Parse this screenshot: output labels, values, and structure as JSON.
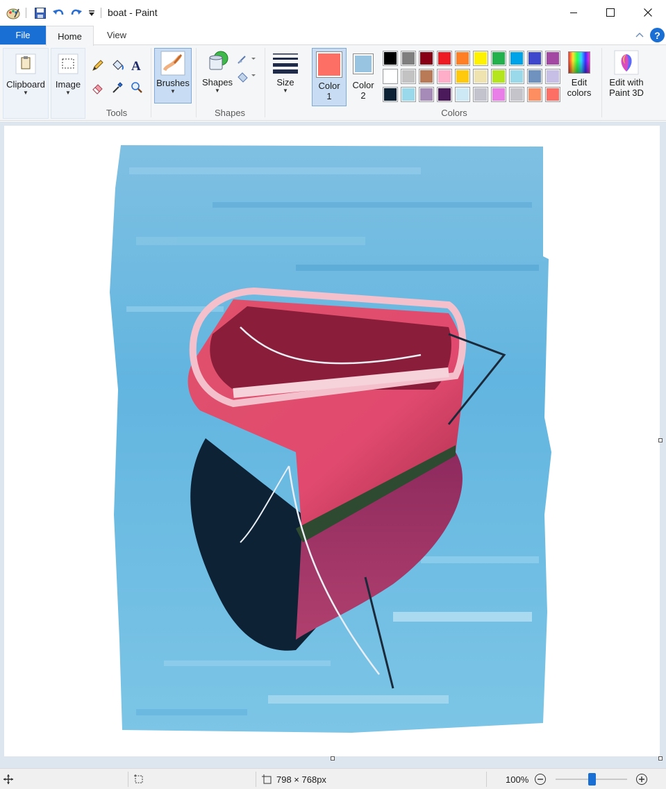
{
  "window": {
    "title": "boat - Paint"
  },
  "tabs": {
    "file": "File",
    "home": "Home",
    "view": "View"
  },
  "help": {
    "label": "?"
  },
  "ribbon": {
    "clipboard": {
      "label": "Clipboard"
    },
    "image": {
      "label": "Image"
    },
    "tools_group": "Tools",
    "brushes": {
      "label": "Brushes"
    },
    "shapes": {
      "label": "Shapes",
      "group": "Shapes"
    },
    "size": {
      "label": "Size"
    },
    "color1": {
      "label": "Color",
      "num": "1",
      "value": "#fd6f64"
    },
    "color2": {
      "label": "Color",
      "num": "2",
      "value": "#99c4e1"
    },
    "colors_group": "Colors",
    "edit_colors": {
      "line1": "Edit",
      "line2": "colors"
    },
    "paint3d": {
      "line1": "Edit with",
      "line2": "Paint 3D"
    }
  },
  "palette": [
    "#000000",
    "#7f7f7f",
    "#880015",
    "#ed1c24",
    "#ff7f27",
    "#fff200",
    "#22b14c",
    "#00a2e8",
    "#3f48cc",
    "#a349a4",
    "#ffffff",
    "#c3c3c3",
    "#b97a57",
    "#ffaec9",
    "#ffc90e",
    "#efe4b0",
    "#b5e61d",
    "#99d9ea",
    "#7092be",
    "#c8bfe7",
    "#0e2236",
    "#9ad8ec",
    "#a68bb8",
    "#4a1a5a",
    "#cde9f5",
    "#c2c3cc",
    "#ea7ee8",
    "#c4c4ca",
    "#fd8e62",
    "#fd6f64"
  ],
  "status": {
    "image_size": "798 × 768px",
    "zoom": "100%",
    "zoom_level": 0.5
  }
}
